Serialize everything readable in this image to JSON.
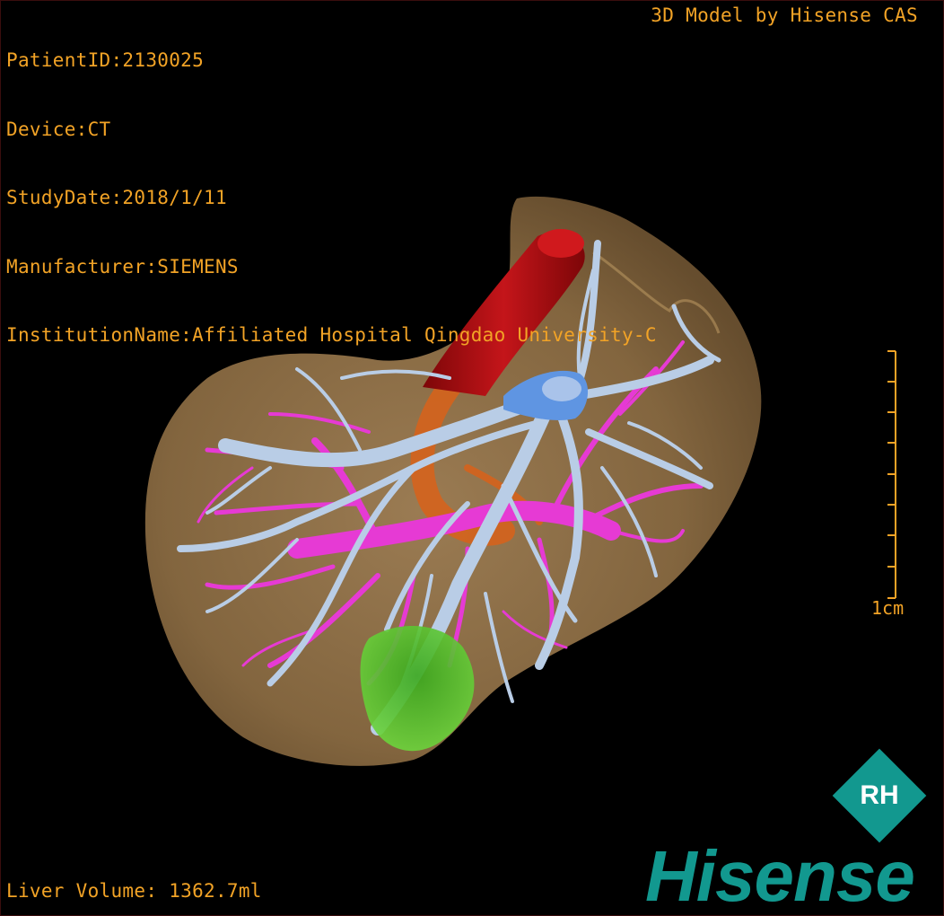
{
  "header": {
    "patient_id": "PatientID:2130025",
    "device": "Device:CT",
    "study_date": "StudyDate:2018/1/11",
    "manufacturer": "Manufacturer:SIEMENS",
    "institution": "InstitutionName:Affiliated Hospital Qingdao University-C"
  },
  "brand_caption": "3D Model by Hisense CAS",
  "scale_bar": {
    "label": "1cm"
  },
  "footer": {
    "liver_volume": "Liver Volume: 1362.7ml"
  },
  "logo": {
    "word": "Hisense",
    "mark_text": "RH"
  },
  "colors": {
    "overlay_text": "#f2a326",
    "liver": "#9c7a4a",
    "aorta": "#b40f12",
    "hepatic_vein": "#b9cde6",
    "portal_vein": "#e63ad4",
    "ivc": "#5f95e2",
    "gallbladder": "#4fc127",
    "artery": "#d9621a",
    "logo": "#12988f"
  },
  "model_parts": [
    "liver",
    "aorta",
    "hepatic-veins",
    "portal-veins",
    "inferior-vena-cava",
    "gallbladder",
    "hepatic-artery"
  ]
}
